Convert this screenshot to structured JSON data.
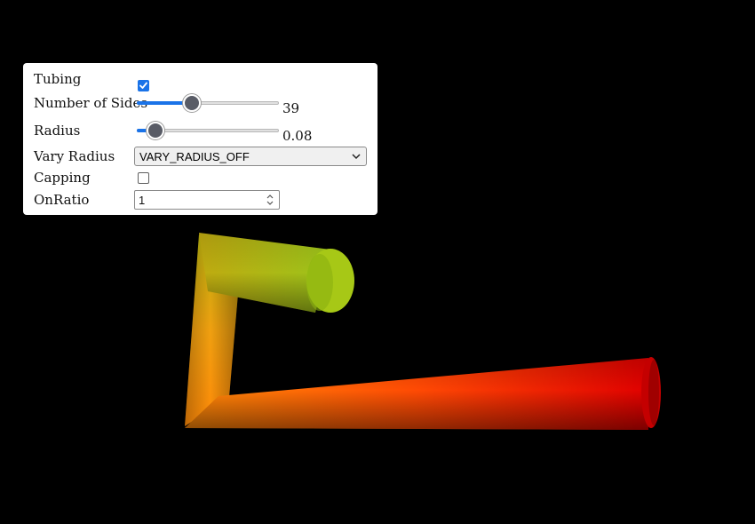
{
  "panel": {
    "tubing": {
      "label": "Tubing",
      "checked": true
    },
    "number_of_sides": {
      "label": "Number of Sides",
      "value": "39",
      "fraction": 0.39
    },
    "radius": {
      "label": "Radius",
      "value": "0.08",
      "fraction": 0.13
    },
    "vary_radius": {
      "label": "Vary Radius",
      "selected": "VARY_RADIUS_OFF"
    },
    "capping": {
      "label": "Capping",
      "checked": false
    },
    "on_ratio": {
      "label": "OnRatio",
      "value": "1"
    }
  },
  "colors": {
    "background": "#000000",
    "accent": "#1a73e8",
    "thumb": "#595c66",
    "tube_start": "#9fc41a",
    "tube_mid": "#ff8c0a",
    "tube_end": "#e80000"
  },
  "icons": {
    "tubing_check": "checkmark-icon",
    "select_arrow": "chevron-down-icon",
    "spinner": "spinner-arrows-icon"
  }
}
